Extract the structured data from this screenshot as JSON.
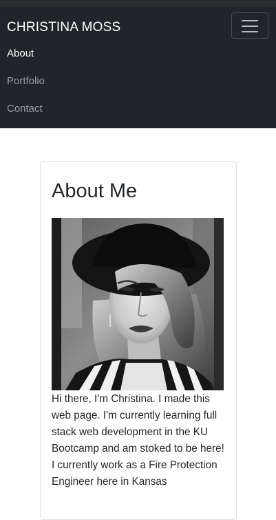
{
  "navbar": {
    "brand": "CHRISTINA MOSS",
    "toggle_icon": "hamburger-menu-icon",
    "links": [
      {
        "label": "About",
        "active": true
      },
      {
        "label": "Portfolio",
        "active": false
      },
      {
        "label": "Contact",
        "active": false
      }
    ]
  },
  "about": {
    "title": "About Me",
    "photo_description": "black-and-white portrait photo",
    "bio": "Hi there, I'm Christina. I made this web page. I'm currently learning full stack web development in the KU Bootcamp and am stoked to be here! I currently work as a Fire Protection Engineer here in Kansas"
  },
  "colors": {
    "navbar_bg": "#212529",
    "nav_active": "#ffffff",
    "nav_inactive": "#9a9da1",
    "card_border": "#dfe1e3"
  }
}
